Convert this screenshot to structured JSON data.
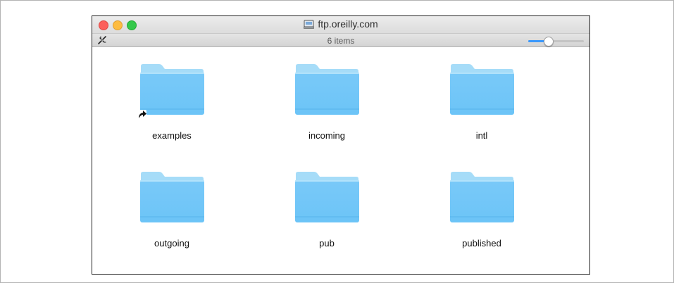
{
  "window": {
    "title": "ftp.oreilly.com",
    "status": "6 items",
    "icon_zoom": 0.35
  },
  "items": [
    {
      "label": "examples",
      "icon": "folder-alias-icon",
      "alias": true
    },
    {
      "label": "incoming",
      "icon": "folder-icon",
      "alias": false
    },
    {
      "label": "intl",
      "icon": "folder-icon",
      "alias": false
    },
    {
      "label": "outgoing",
      "icon": "folder-icon",
      "alias": false
    },
    {
      "label": "pub",
      "icon": "folder-icon",
      "alias": false
    },
    {
      "label": "published",
      "icon": "folder-icon",
      "alias": false
    }
  ],
  "colors": {
    "folder_light": "#a6dcf8",
    "folder_main": "#6cc4f7",
    "close": "#fc605c",
    "minimize": "#fdbc40",
    "zoom": "#34c84a",
    "accent": "#3b99fc"
  }
}
